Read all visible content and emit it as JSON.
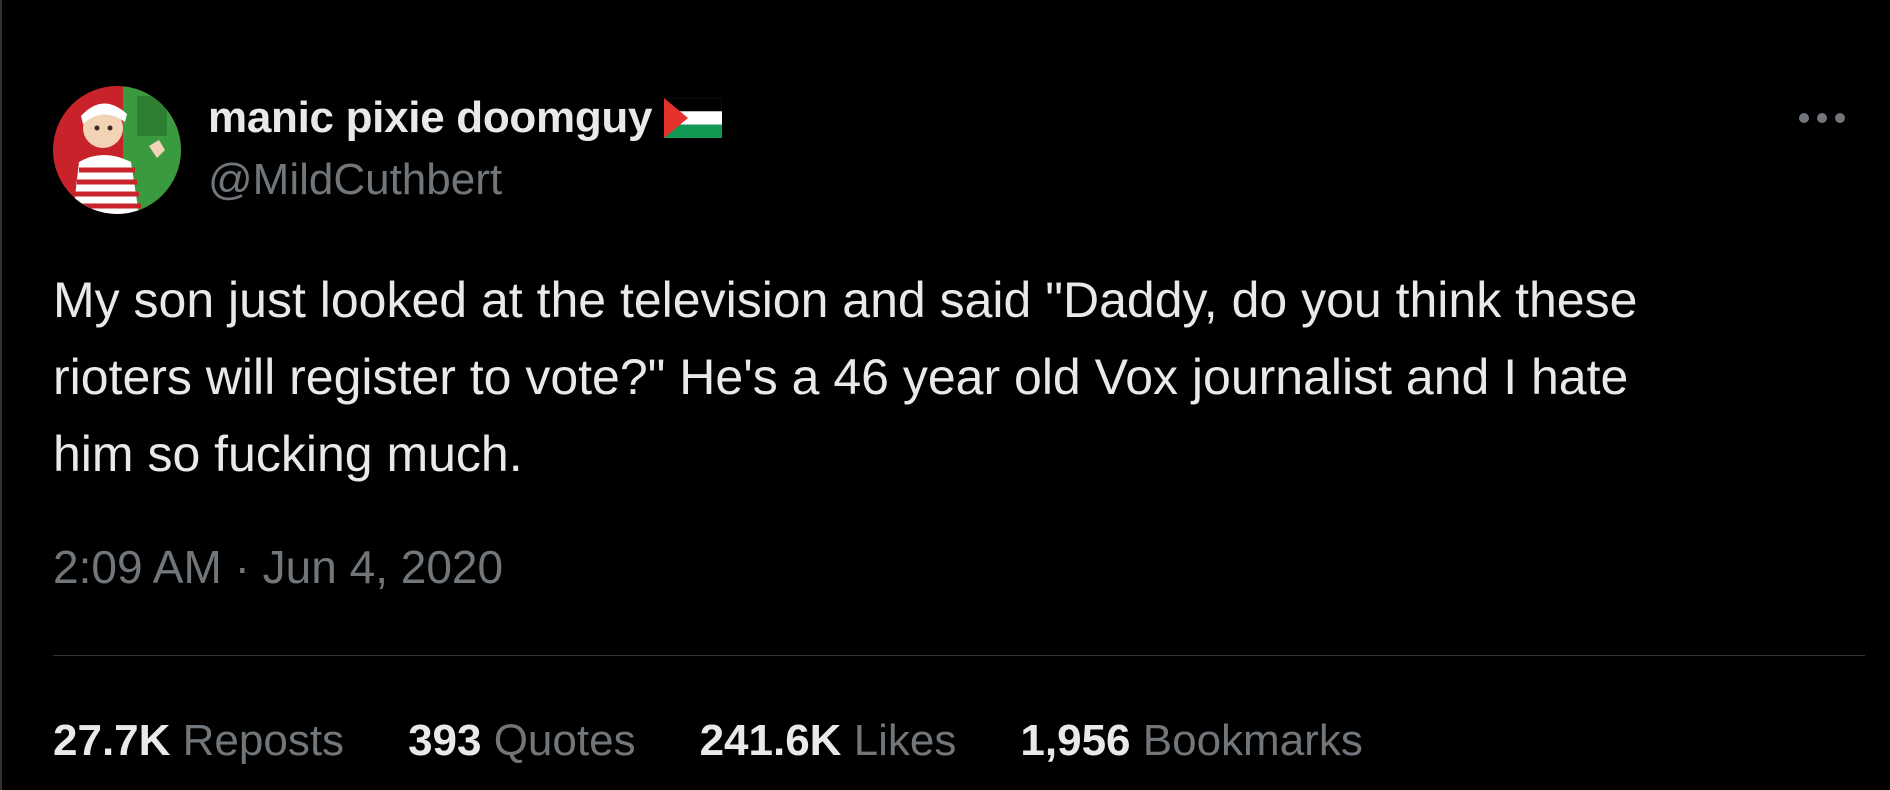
{
  "author": {
    "display_name": "manic pixie doomguy",
    "handle": "@MildCuthbert",
    "flag_icon": "palestine-flag-icon",
    "avatar_icon": "profile-avatar"
  },
  "tweet": {
    "text": "My son just looked at the television and said \"Daddy, do you think these\nrioters will register to vote?\" He's a 46 year old Vox journalist and I hate\nhim so fucking much.",
    "time": "2:09 AM",
    "separator": "·",
    "date": "Jun 4, 2020"
  },
  "stats": {
    "reposts": {
      "count": "27.7K",
      "label": "Reposts"
    },
    "quotes": {
      "count": "393",
      "label": "Quotes"
    },
    "likes": {
      "count": "241.6K",
      "label": "Likes"
    },
    "bookmarks": {
      "count": "1,956",
      "label": "Bookmarks"
    }
  },
  "more_icon": "more-horizontal-icon",
  "colors": {
    "background": "#000000",
    "primary_text": "#e7e9ea",
    "secondary_text": "#71767b",
    "divider": "#2f3336"
  }
}
